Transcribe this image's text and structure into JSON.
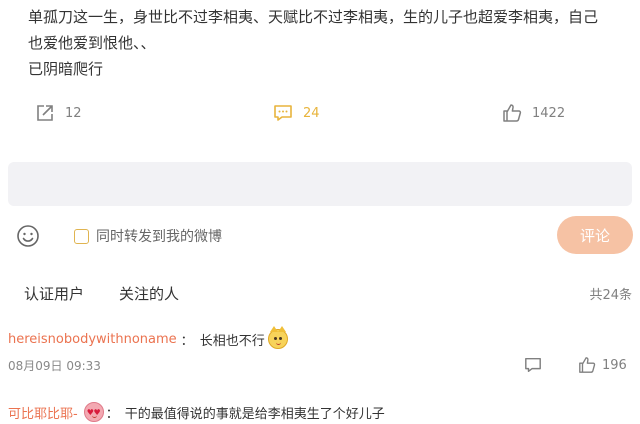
{
  "post": {
    "line1": "单孤刀这一生，身世比不过李相夷、天赋比不过李相夷，生的儿子也超爱李相夷，自己",
    "line2": "也爱他爱到恨他、、",
    "line3": "已阴暗爬行"
  },
  "actions": {
    "share_count": "12",
    "comment_count": "24",
    "like_count": "1422"
  },
  "comment_box": {
    "value": "",
    "placeholder": ""
  },
  "composer": {
    "forward_label": "同时转发到我的微博",
    "submit_label": "评论"
  },
  "tabs": [
    "认证用户",
    "关注的人"
  ],
  "total": "共24条",
  "comments": [
    {
      "user": "hereisnobodywithnoname",
      "colon": "：",
      "text": "长相也不行",
      "emoji": "cat-face",
      "time": "08月09日 09:33",
      "likes": "196"
    },
    {
      "user": "可比耶比耶-",
      "emoji": "heart-eyes-face",
      "colon": "：",
      "text": "干的最值得说的事就是给李相夷生了个好儿子"
    }
  ],
  "colors": {
    "username": "#eb7350",
    "comment_icon": "#e8b43c",
    "submit_bg": "#f6c2a4",
    "input_bg": "#f2f2f5"
  }
}
